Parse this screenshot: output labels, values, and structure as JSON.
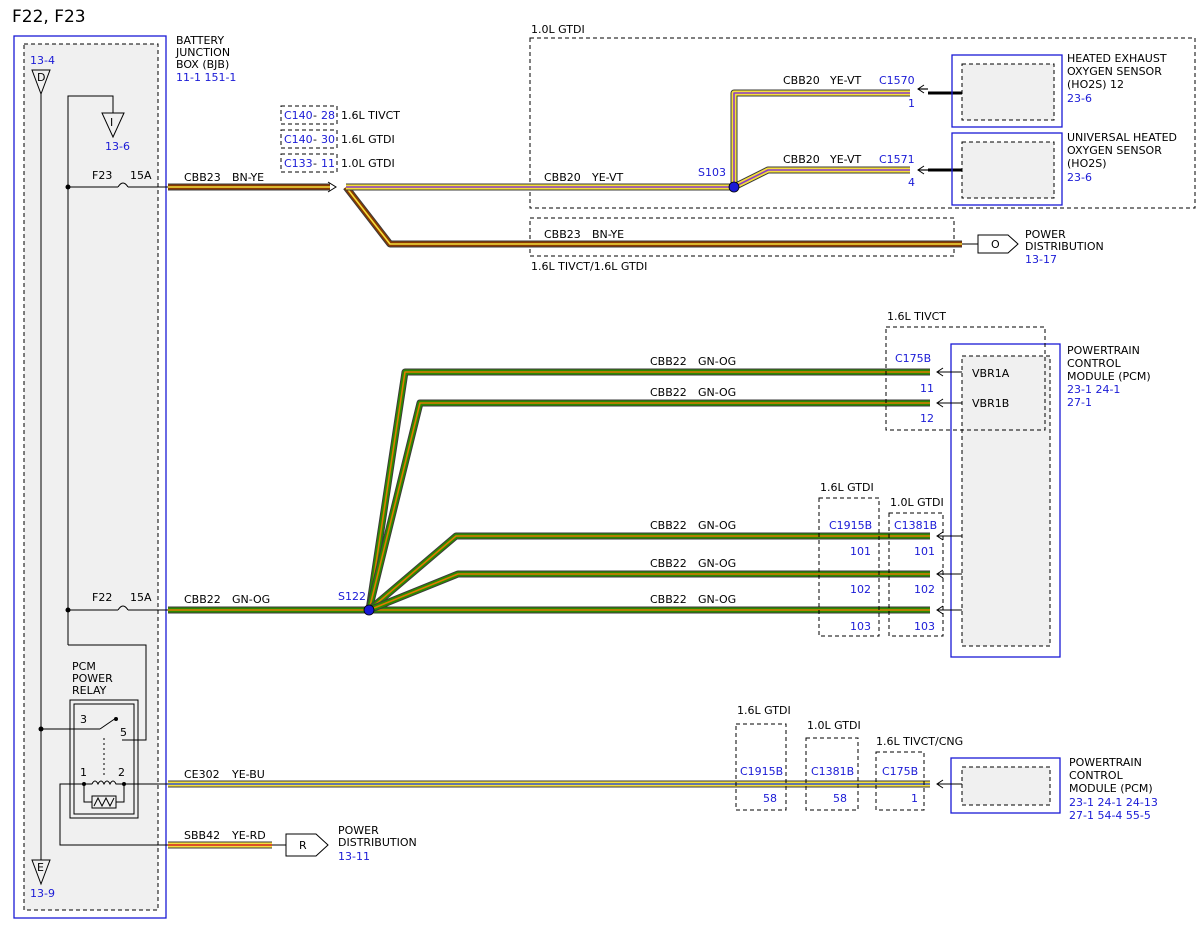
{
  "title": "F22, F23",
  "bjb": {
    "label_lines": [
      "BATTERY",
      "JUNCTION",
      "BOX (BJB)"
    ],
    "refs": "11-1    151-1",
    "conn_d": {
      "letter": "D",
      "ref": "13-4"
    },
    "conn_i": {
      "letter": "I",
      "ref": "13-6"
    },
    "conn_e": {
      "letter": "E",
      "ref": "13-9"
    },
    "fuse_f23": {
      "name": "F23",
      "rating": "15A"
    },
    "fuse_f22": {
      "name": "F22",
      "rating": "15A"
    },
    "relay": {
      "label_lines": [
        "PCM",
        "POWER",
        "RELAY"
      ],
      "pins": [
        "3",
        "5",
        "1",
        "2"
      ]
    }
  },
  "variant_connectors": [
    {
      "conn": "C140",
      "pin": "28",
      "variant": "1.6L TIVCT"
    },
    {
      "conn": "C140",
      "pin": "30",
      "variant": "1.6L GTDI"
    },
    {
      "conn": "C133",
      "pin": "11",
      "variant": "1.0L GTDI"
    }
  ],
  "wires": {
    "cbb23_main": {
      "circuit": "CBB23",
      "color": "BN-YE"
    },
    "cbb20_main": {
      "circuit": "CBB20",
      "color": "YE-VT"
    },
    "cbb20_ho2s12": {
      "circuit": "CBB20",
      "color": "YE-VT"
    },
    "cbb20_ho2s": {
      "circuit": "CBB20",
      "color": "YE-VT"
    },
    "cbb23_branch": {
      "circuit": "CBB23",
      "color": "BN-YE"
    },
    "cbb22_main": {
      "circuit": "CBB22",
      "color": "GN-OG"
    },
    "cbb22_vbr1a": {
      "circuit": "CBB22",
      "color": "GN-OG"
    },
    "cbb22_vbr1b": {
      "circuit": "CBB22",
      "color": "GN-OG"
    },
    "cbb22_101": {
      "circuit": "CBB22",
      "color": "GN-OG"
    },
    "cbb22_102": {
      "circuit": "CBB22",
      "color": "GN-OG"
    },
    "cbb22_103": {
      "circuit": "CBB22",
      "color": "GN-OG"
    },
    "ce302": {
      "circuit": "CE302",
      "color": "YE-BU"
    },
    "sbb42": {
      "circuit": "SBB42",
      "color": "YE-RD"
    }
  },
  "splices": {
    "s103": "S103",
    "s122": "S122"
  },
  "gtdi10_box_label": "1.0L GTDI",
  "branch_box_label": "1.6L TIVCT/1.6L GTDI",
  "ho2s12": {
    "conn": "C1570",
    "pin": "1",
    "label_lines": [
      "HEATED EXHAUST",
      "OXYGEN SENSOR",
      "(HO2S) 12"
    ],
    "ref": "23-6"
  },
  "ho2s": {
    "conn": "C1571",
    "pin": "4",
    "label_lines": [
      "UNIVERSAL HEATED",
      "OXYGEN SENSOR",
      "(HO2S)"
    ],
    "ref": "23-6"
  },
  "power_dist_o": {
    "letter": "O",
    "label_lines": [
      "POWER",
      "DISTRIBUTION"
    ],
    "ref": "13-17"
  },
  "power_dist_r": {
    "letter": "R",
    "label_lines": [
      "POWER",
      "DISTRIBUTION"
    ],
    "ref": "13-11"
  },
  "pcm_upper": {
    "label_lines": [
      "POWERTRAIN",
      "CONTROL",
      "MODULE (PCM)"
    ],
    "refs_line1": "23-1    24-1",
    "refs_line2": "27-1",
    "tivct_label": "1.6L TIVCT",
    "c175b": {
      "conn": "C175B",
      "pins": [
        "11",
        "12"
      ],
      "pin_names": [
        "VBR1A",
        "VBR1B"
      ]
    },
    "gtdi16_label": "1.6L GTDI",
    "gtdi10_label": "1.0L GTDI",
    "c1915b": {
      "conn": "C1915B",
      "pins": [
        "101",
        "102",
        "103"
      ]
    },
    "c1381b": {
      "conn": "C1381B",
      "pins": [
        "101",
        "102",
        "103"
      ]
    }
  },
  "pcm_lower": {
    "label_lines": [
      "POWERTRAIN",
      "CONTROL",
      "MODULE (PCM)"
    ],
    "refs_line1": "23-1    24-1    24-13",
    "refs_line2": "27-1    54-4    55-5",
    "boxes": [
      {
        "variant": "1.6L GTDI",
        "conn": "C1915B",
        "pin": "58"
      },
      {
        "variant": "1.0L GTDI",
        "conn": "C1381B",
        "pin": "58"
      },
      {
        "variant": "1.6L TIVCT/CNG",
        "conn": "C175B",
        "pin": "1"
      }
    ]
  },
  "colors": {
    "blue": "#1a1ad6",
    "brown": "#8b3a00",
    "yellow": "#f5df3c",
    "green": "#2d8a00",
    "orange": "#e07a00",
    "red": "#d42020",
    "blue_wire": "#3355cc",
    "violet": "#8a3cc8"
  }
}
